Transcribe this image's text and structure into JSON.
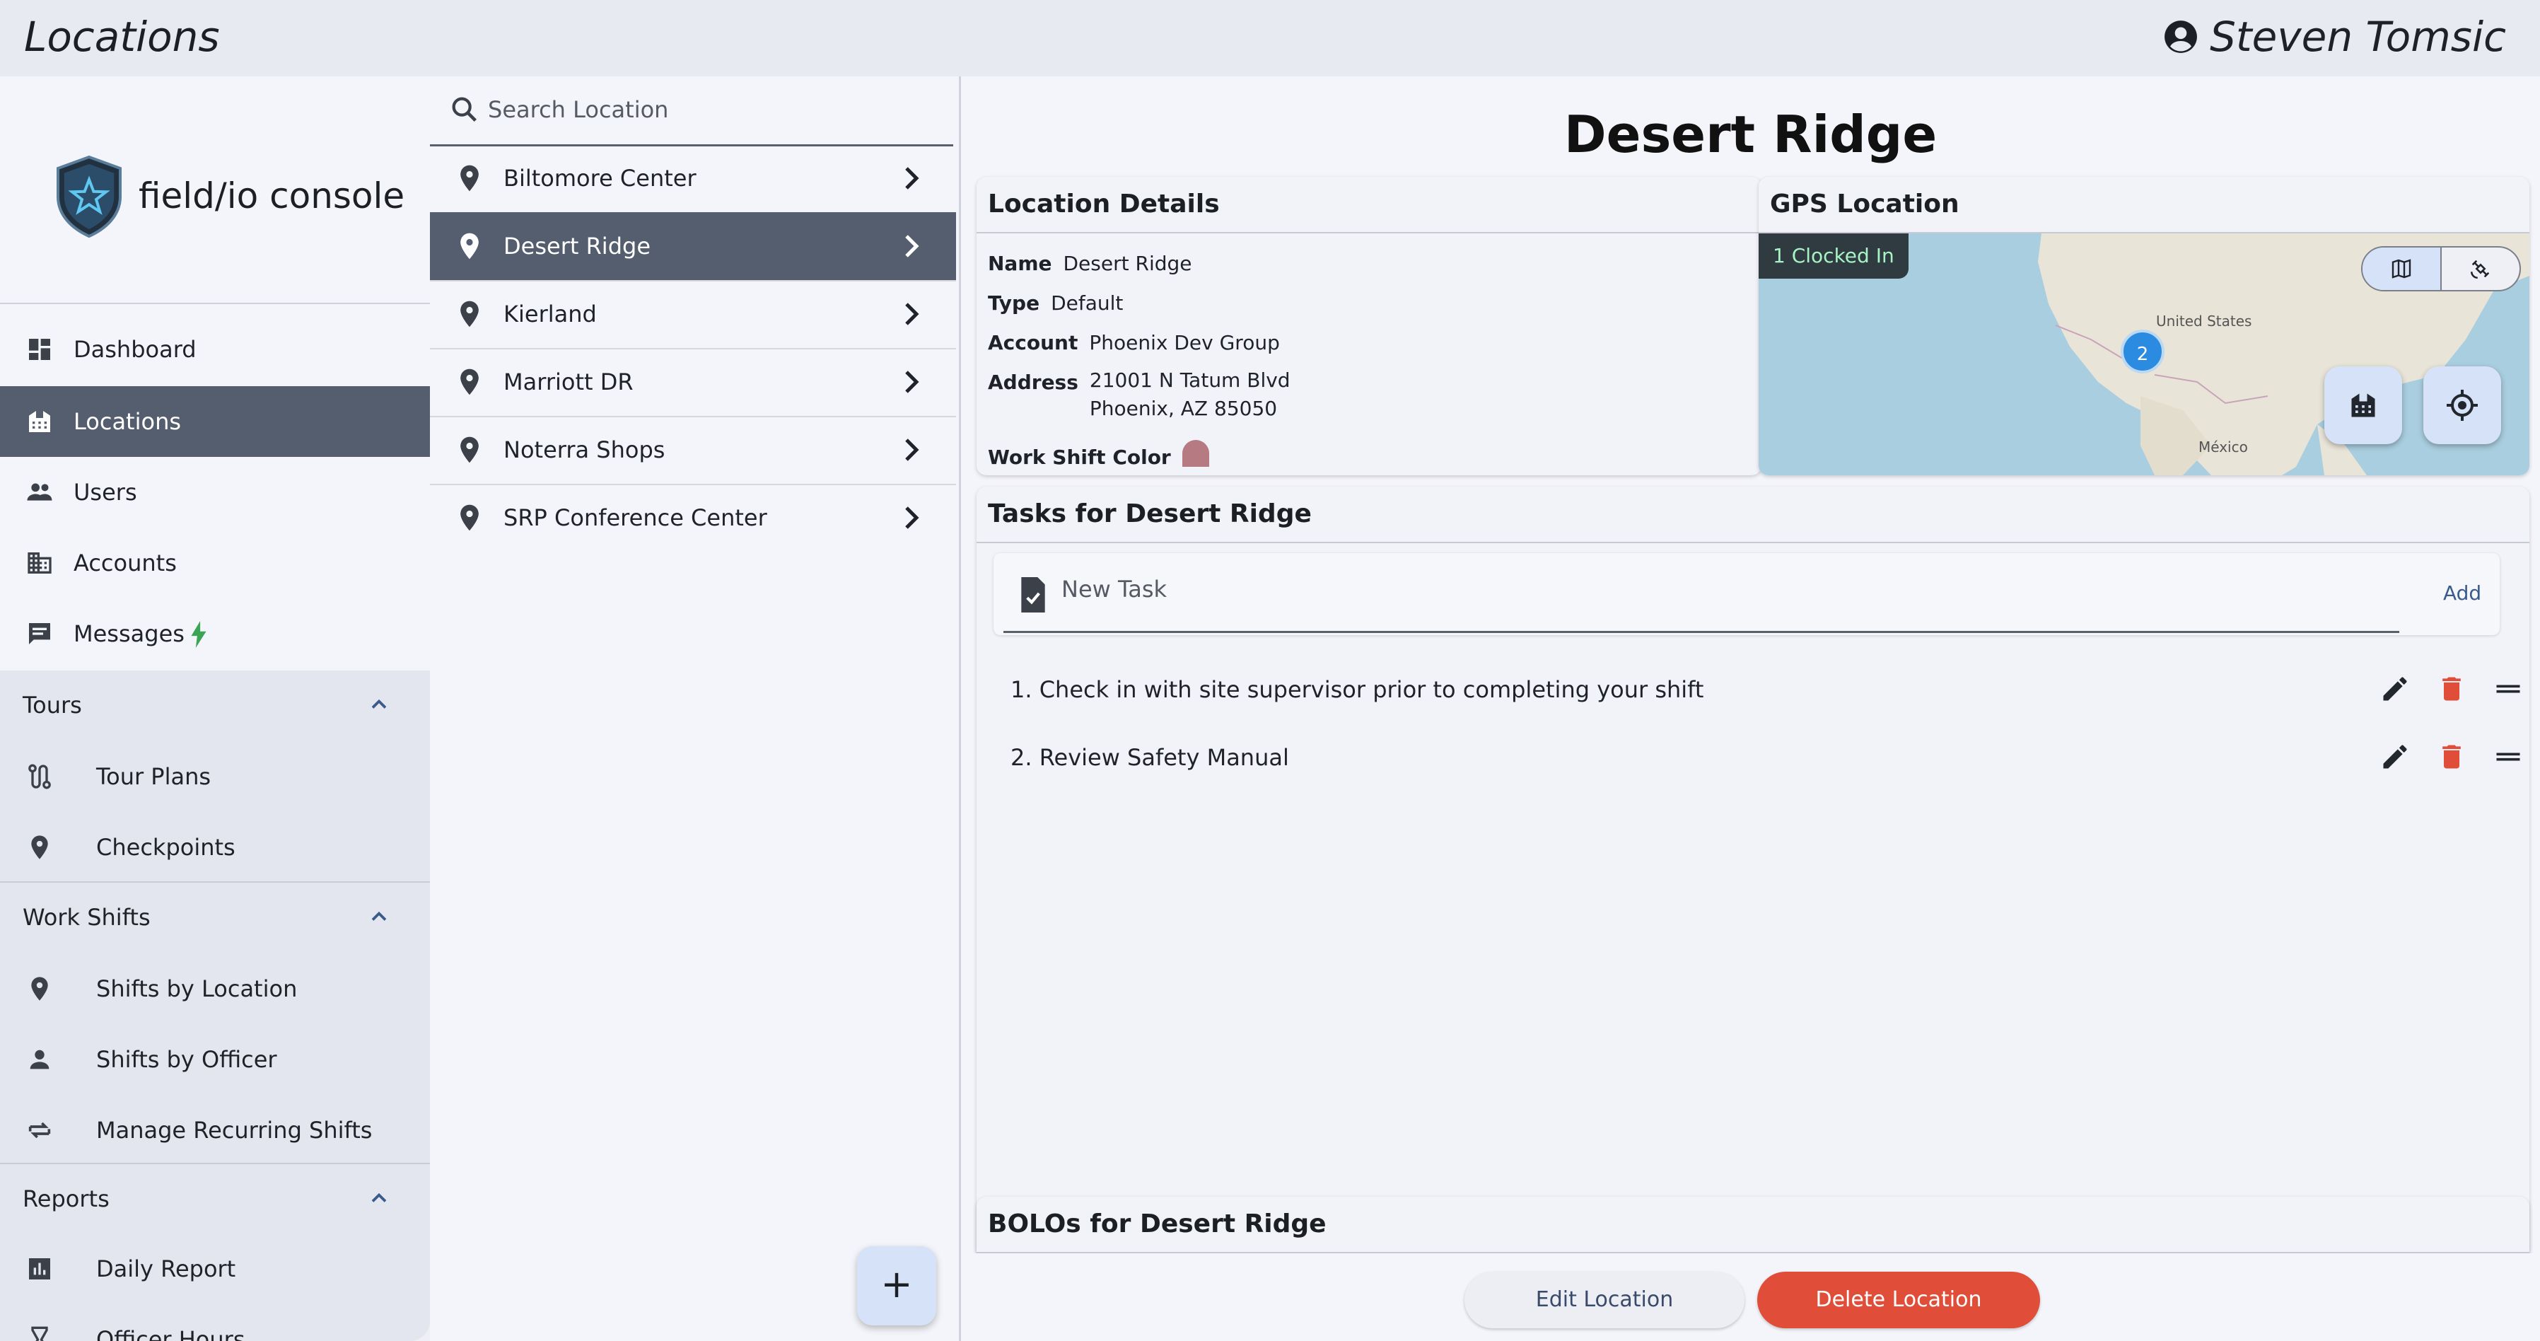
{
  "header": {
    "title": "Locations",
    "user_name": "Steven Tomsic"
  },
  "sidebar": {
    "brand": "field/io console",
    "nav": [
      {
        "label": "Dashboard",
        "icon": "dashboard-icon"
      },
      {
        "label": "Locations",
        "icon": "building-icon",
        "active": true
      },
      {
        "label": "Users",
        "icon": "users-icon"
      },
      {
        "label": "Accounts",
        "icon": "accounts-icon"
      },
      {
        "label": "Messages",
        "icon": "message-icon",
        "badge_icon": "bolt-icon"
      }
    ],
    "sections": [
      {
        "label": "Tours",
        "items": [
          {
            "label": "Tour Plans",
            "icon": "route-icon"
          },
          {
            "label": "Checkpoints",
            "icon": "pin-icon"
          }
        ]
      },
      {
        "label": "Work Shifts",
        "items": [
          {
            "label": "Shifts by Location",
            "icon": "pin-icon"
          },
          {
            "label": "Shifts by Officer",
            "icon": "person-icon"
          },
          {
            "label": "Manage Recurring Shifts",
            "icon": "repeat-icon"
          }
        ]
      },
      {
        "label": "Reports",
        "items": [
          {
            "label": "Daily Report",
            "icon": "chart-icon"
          },
          {
            "label": "Officer Hours",
            "icon": "hourglass-icon"
          }
        ]
      }
    ]
  },
  "locations_list": {
    "search_placeholder": "Search Location",
    "items": [
      {
        "label": "Biltomore Center"
      },
      {
        "label": "Desert Ridge",
        "active": true
      },
      {
        "label": "Kierland"
      },
      {
        "label": "Marriott DR"
      },
      {
        "label": "Noterra Shops"
      },
      {
        "label": "SRP Conference Center"
      }
    ],
    "add_button": "+"
  },
  "detail": {
    "title": "Desert Ridge",
    "location_details": {
      "heading": "Location Details",
      "name_label": "Name",
      "name_value": "Desert Ridge",
      "type_label": "Type",
      "type_value": "Default",
      "account_label": "Account",
      "account_value": "Phoenix Dev Group",
      "address_label": "Address",
      "address_line1": "21001 N Tatum Blvd",
      "address_line2": "Phoenix, AZ 85050",
      "color_label": "Work Shift Color",
      "color_value": "#b57a82"
    },
    "gps": {
      "heading": "GPS Location",
      "clocked_in": "1 Clocked In",
      "cluster_count": "2",
      "map_label_us": "United States",
      "map_label_mx": "México"
    },
    "tasks": {
      "heading": "Tasks for Desert Ridge",
      "new_task_placeholder": "New Task",
      "add_label": "Add",
      "items": [
        "1. Check in with site supervisor prior to completing your shift",
        "2. Review Safety Manual"
      ]
    },
    "bolos": {
      "heading": "BOLOs for Desert Ridge"
    },
    "buttons": {
      "edit": "Edit Location",
      "delete": "Delete Location"
    }
  },
  "colors": {
    "accent": "#545e6e",
    "danger": "#e04e3a",
    "primary_light": "#d6e2f7",
    "success_text": "#a7f3c4"
  }
}
